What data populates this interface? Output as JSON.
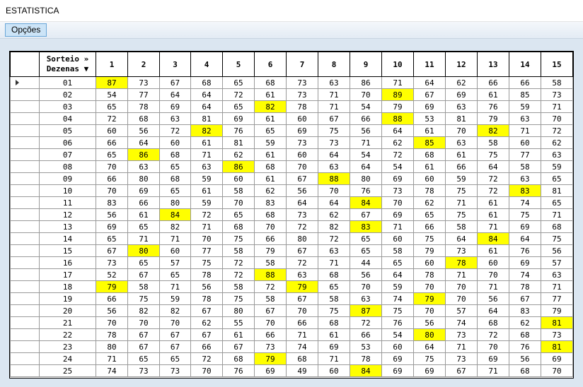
{
  "window": {
    "title": "ESTATISTICA"
  },
  "menu": {
    "options_label": "Opções"
  },
  "grid": {
    "header_sorteio": "Sorteio »",
    "header_dezenas": "Dezenas ▼",
    "columns": [
      "1",
      "2",
      "3",
      "4",
      "5",
      "6",
      "7",
      "8",
      "9",
      "10",
      "11",
      "12",
      "13",
      "14",
      "15"
    ],
    "highlight_color": "#ffff00",
    "rows": [
      {
        "id": "01",
        "values": [
          "87",
          "73",
          "67",
          "68",
          "65",
          "68",
          "73",
          "63",
          "86",
          "71",
          "64",
          "62",
          "66",
          "66",
          "58"
        ],
        "hl": [
          0
        ]
      },
      {
        "id": "02",
        "values": [
          "54",
          "77",
          "64",
          "64",
          "72",
          "61",
          "73",
          "71",
          "70",
          "89",
          "67",
          "69",
          "61",
          "85",
          "73"
        ],
        "hl": [
          9
        ]
      },
      {
        "id": "03",
        "values": [
          "65",
          "78",
          "69",
          "64",
          "65",
          "82",
          "78",
          "71",
          "54",
          "79",
          "69",
          "63",
          "76",
          "59",
          "71"
        ],
        "hl": [
          5
        ]
      },
      {
        "id": "04",
        "values": [
          "72",
          "68",
          "63",
          "81",
          "69",
          "61",
          "60",
          "67",
          "66",
          "88",
          "53",
          "81",
          "79",
          "63",
          "70"
        ],
        "hl": [
          9
        ]
      },
      {
        "id": "05",
        "values": [
          "60",
          "56",
          "72",
          "82",
          "76",
          "65",
          "69",
          "75",
          "56",
          "64",
          "61",
          "70",
          "82",
          "71",
          "72"
        ],
        "hl": [
          3,
          12
        ]
      },
      {
        "id": "06",
        "values": [
          "66",
          "64",
          "60",
          "61",
          "81",
          "59",
          "73",
          "73",
          "71",
          "62",
          "85",
          "63",
          "58",
          "60",
          "62"
        ],
        "hl": [
          10
        ]
      },
      {
        "id": "07",
        "values": [
          "65",
          "86",
          "68",
          "71",
          "62",
          "61",
          "60",
          "64",
          "54",
          "72",
          "68",
          "61",
          "75",
          "77",
          "63"
        ],
        "hl": [
          1
        ]
      },
      {
        "id": "08",
        "values": [
          "70",
          "63",
          "65",
          "63",
          "86",
          "68",
          "70",
          "63",
          "64",
          "54",
          "61",
          "66",
          "64",
          "58",
          "59"
        ],
        "hl": [
          4
        ]
      },
      {
        "id": "09",
        "values": [
          "66",
          "80",
          "68",
          "59",
          "60",
          "61",
          "67",
          "88",
          "80",
          "69",
          "60",
          "59",
          "72",
          "63",
          "65"
        ],
        "hl": [
          7
        ]
      },
      {
        "id": "10",
        "values": [
          "70",
          "69",
          "65",
          "61",
          "58",
          "62",
          "56",
          "70",
          "76",
          "73",
          "78",
          "75",
          "72",
          "83",
          "81"
        ],
        "hl": [
          13
        ]
      },
      {
        "id": "11",
        "values": [
          "83",
          "66",
          "80",
          "59",
          "70",
          "83",
          "64",
          "64",
          "84",
          "70",
          "62",
          "71",
          "61",
          "74",
          "65"
        ],
        "hl": [
          8
        ]
      },
      {
        "id": "12",
        "values": [
          "56",
          "61",
          "84",
          "72",
          "65",
          "68",
          "73",
          "62",
          "67",
          "69",
          "65",
          "75",
          "61",
          "75",
          "71"
        ],
        "hl": [
          2
        ]
      },
      {
        "id": "13",
        "values": [
          "69",
          "65",
          "82",
          "71",
          "68",
          "70",
          "72",
          "82",
          "83",
          "71",
          "66",
          "58",
          "71",
          "69",
          "68"
        ],
        "hl": [
          8
        ]
      },
      {
        "id": "14",
        "values": [
          "65",
          "71",
          "71",
          "70",
          "75",
          "66",
          "80",
          "72",
          "65",
          "60",
          "75",
          "64",
          "84",
          "64",
          "75"
        ],
        "hl": [
          12
        ]
      },
      {
        "id": "15",
        "values": [
          "67",
          "80",
          "60",
          "77",
          "58",
          "79",
          "67",
          "63",
          "65",
          "58",
          "79",
          "73",
          "61",
          "76",
          "56"
        ],
        "hl": [
          1
        ]
      },
      {
        "id": "16",
        "values": [
          "73",
          "65",
          "57",
          "75",
          "72",
          "58",
          "72",
          "71",
          "44",
          "65",
          "60",
          "78",
          "60",
          "69",
          "57"
        ],
        "hl": [
          11
        ]
      },
      {
        "id": "17",
        "values": [
          "52",
          "67",
          "65",
          "78",
          "72",
          "88",
          "63",
          "68",
          "56",
          "64",
          "78",
          "71",
          "70",
          "74",
          "63"
        ],
        "hl": [
          5
        ]
      },
      {
        "id": "18",
        "values": [
          "79",
          "58",
          "71",
          "56",
          "58",
          "72",
          "79",
          "65",
          "70",
          "59",
          "70",
          "70",
          "71",
          "78",
          "71"
        ],
        "hl": [
          0,
          6
        ]
      },
      {
        "id": "19",
        "values": [
          "66",
          "75",
          "59",
          "78",
          "75",
          "58",
          "67",
          "58",
          "63",
          "74",
          "79",
          "70",
          "56",
          "67",
          "77"
        ],
        "hl": [
          10
        ]
      },
      {
        "id": "20",
        "values": [
          "56",
          "82",
          "82",
          "67",
          "80",
          "67",
          "70",
          "75",
          "87",
          "75",
          "70",
          "57",
          "64",
          "83",
          "79"
        ],
        "hl": [
          8
        ]
      },
      {
        "id": "21",
        "values": [
          "70",
          "70",
          "70",
          "62",
          "55",
          "70",
          "66",
          "68",
          "72",
          "76",
          "56",
          "74",
          "68",
          "62",
          "81"
        ],
        "hl": [
          14
        ]
      },
      {
        "id": "22",
        "values": [
          "78",
          "67",
          "67",
          "67",
          "61",
          "66",
          "71",
          "61",
          "66",
          "54",
          "80",
          "73",
          "72",
          "68",
          "73"
        ],
        "hl": [
          10
        ]
      },
      {
        "id": "23",
        "values": [
          "80",
          "67",
          "67",
          "66",
          "67",
          "73",
          "74",
          "69",
          "53",
          "60",
          "64",
          "71",
          "70",
          "76",
          "81"
        ],
        "hl": [
          14
        ]
      },
      {
        "id": "24",
        "values": [
          "71",
          "65",
          "65",
          "72",
          "68",
          "79",
          "68",
          "71",
          "78",
          "69",
          "75",
          "73",
          "69",
          "56",
          "69"
        ],
        "hl": [
          5
        ]
      },
      {
        "id": "25",
        "values": [
          "74",
          "73",
          "73",
          "70",
          "76",
          "69",
          "49",
          "60",
          "84",
          "69",
          "69",
          "67",
          "71",
          "68",
          "70"
        ],
        "hl": [
          8
        ]
      }
    ]
  }
}
